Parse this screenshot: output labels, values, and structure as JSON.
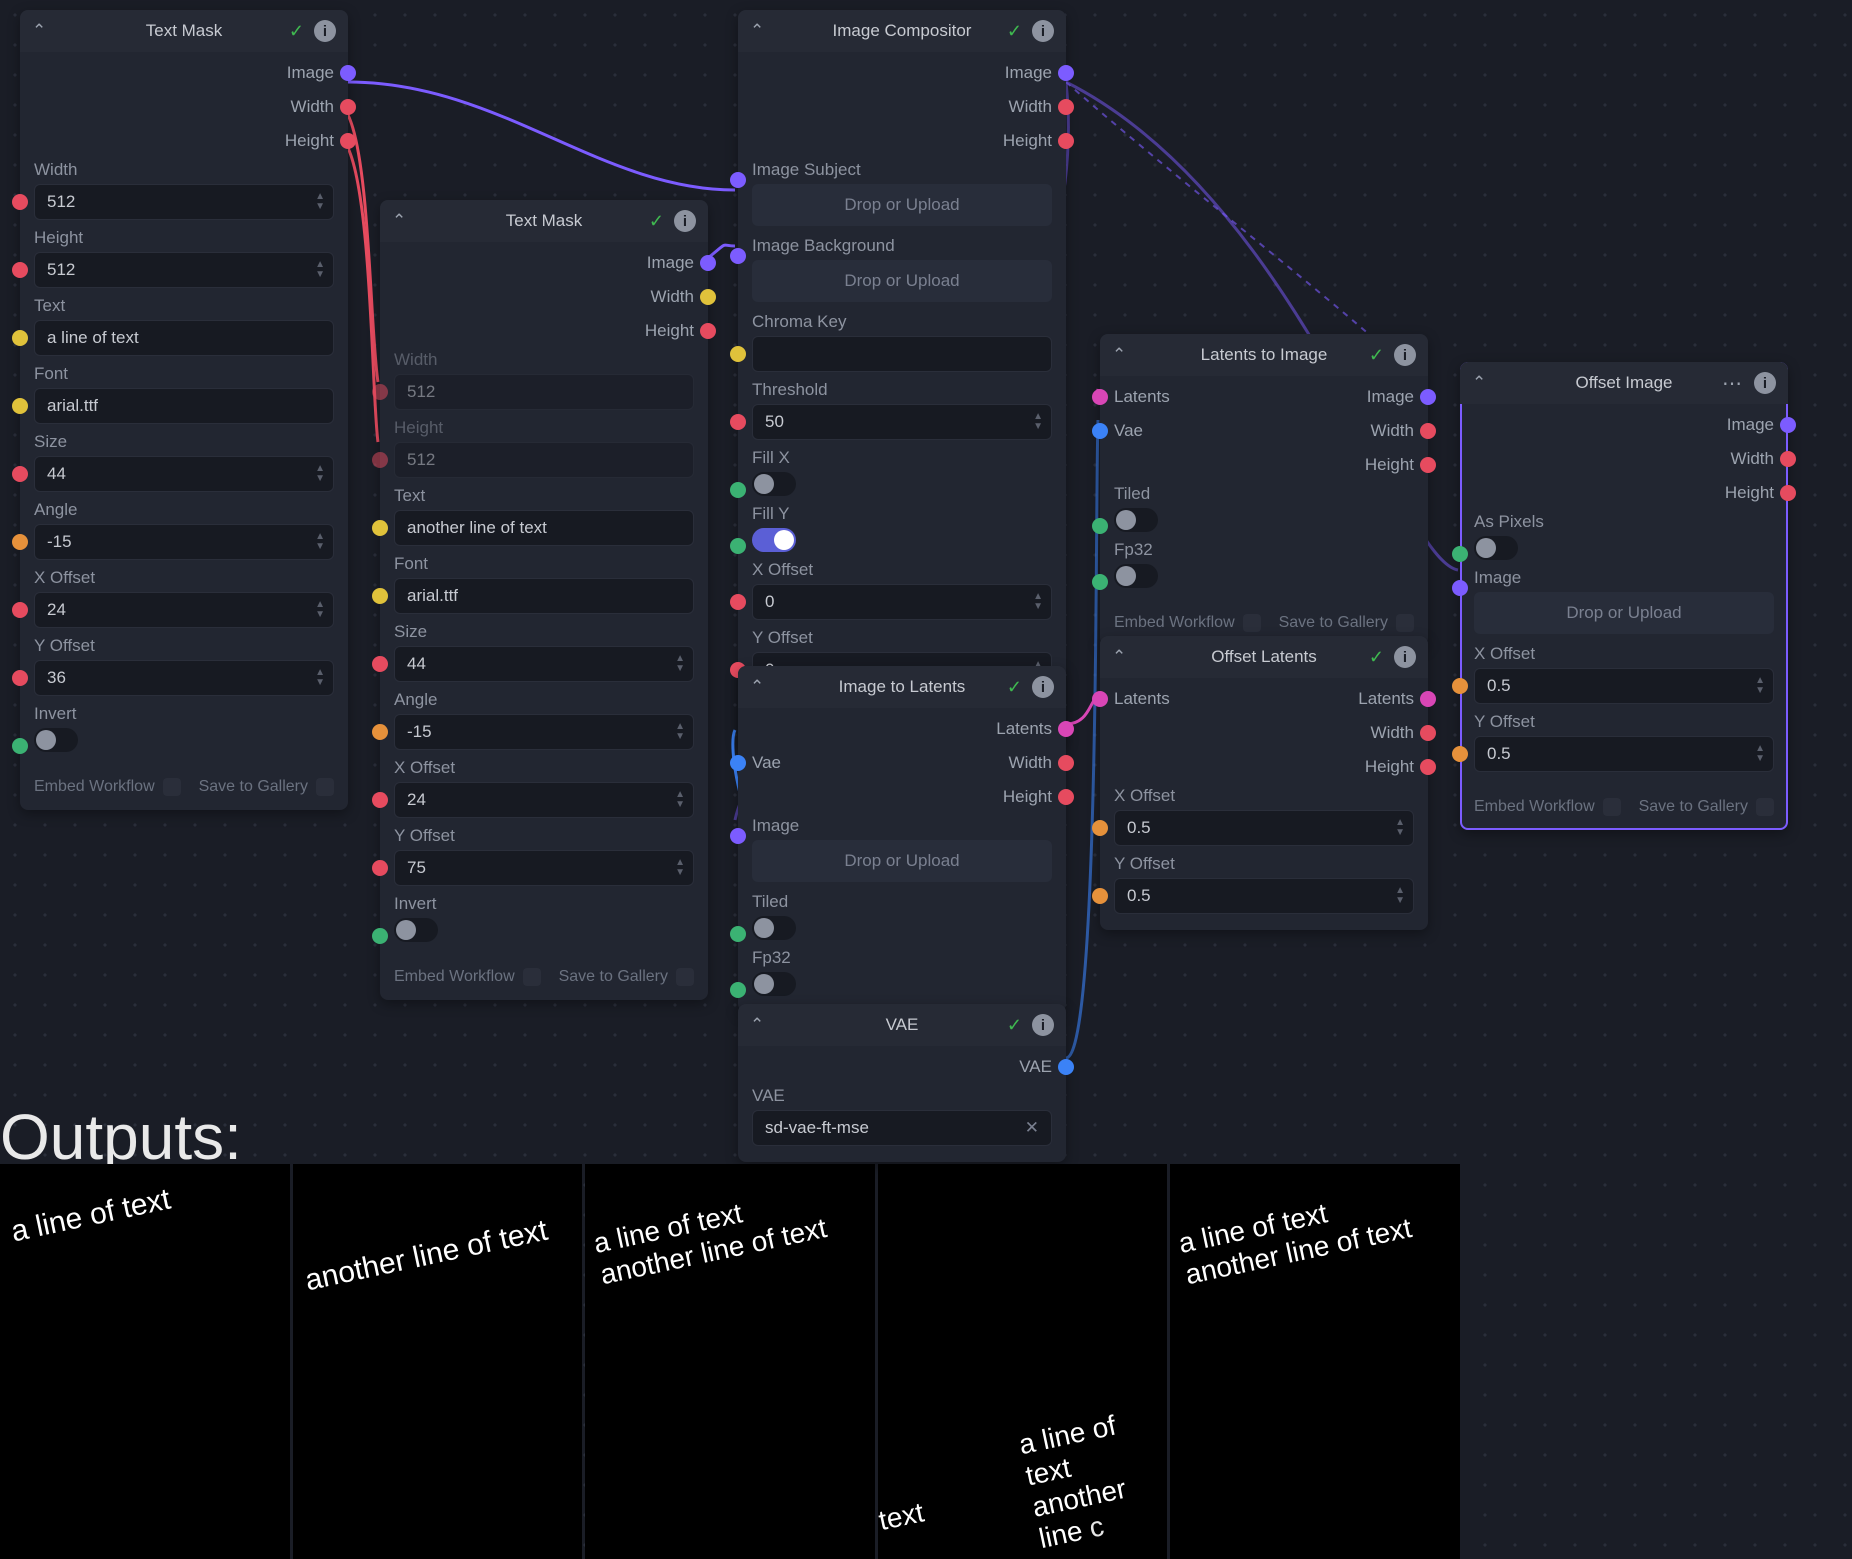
{
  "colors": {
    "purple": "#7c5cff",
    "red": "#e64b5f",
    "orange": "#e6913b",
    "yellow": "#e0c23b",
    "green": "#3bb273",
    "teal": "#2bb5b5",
    "blue": "#3b82f6",
    "magenta": "#d946b6"
  },
  "common": {
    "drop": "Drop or Upload",
    "embed": "Embed Workflow",
    "save": "Save to Gallery"
  },
  "outputs_label": "Outputs:",
  "outputs": {
    "line1": "a line of text",
    "line2": "another line of text",
    "crop": "of text"
  },
  "nodes": {
    "textmask1": {
      "title": "Text Mask",
      "outputs": [
        "Image",
        "Width",
        "Height"
      ],
      "widthLabel": "Width",
      "widthValue": "512",
      "heightLabel": "Height",
      "heightValue": "512",
      "textLabel": "Text",
      "textValue": "a line of text",
      "fontLabel": "Font",
      "fontValue": "arial.ttf",
      "sizeLabel": "Size",
      "sizeValue": "44",
      "angleLabel": "Angle",
      "angleValue": "-15",
      "xoffLabel": "X Offset",
      "xoffValue": "24",
      "yoffLabel": "Y Offset",
      "yoffValue": "36",
      "invertLabel": "Invert"
    },
    "textmask2": {
      "title": "Text Mask",
      "outputs": [
        "Image",
        "Width",
        "Height"
      ],
      "widthLabel": "Width",
      "widthValue": "512",
      "heightLabel": "Height",
      "heightValue": "512",
      "textLabel": "Text",
      "textValue": "another line of text",
      "fontLabel": "Font",
      "fontValue": "arial.ttf",
      "sizeLabel": "Size",
      "sizeValue": "44",
      "angleLabel": "Angle",
      "angleValue": "-15",
      "xoffLabel": "X Offset",
      "xoffValue": "24",
      "yoffLabel": "Y Offset",
      "yoffValue": "75",
      "invertLabel": "Invert"
    },
    "compositor": {
      "title": "Image Compositor",
      "outputs": [
        "Image",
        "Width",
        "Height"
      ],
      "subjLabel": "Image Subject",
      "bgLabel": "Image Background",
      "chromaLabel": "Chroma Key",
      "threshLabel": "Threshold",
      "threshValue": "50",
      "fillxLabel": "Fill X",
      "fillyLabel": "Fill Y",
      "xoffLabel": "X Offset",
      "xoffValue": "0",
      "yoffLabel": "Y Offset",
      "yoffValue": "0"
    },
    "i2l": {
      "title": "Image to Latents",
      "outputs": [
        "Latents",
        "Width",
        "Height"
      ],
      "vaeLabel": "Vae",
      "imageLabel": "Image",
      "tiledLabel": "Tiled",
      "fp32Label": "Fp32"
    },
    "vae": {
      "title": "VAE",
      "outLabel": "VAE",
      "fieldLabel": "VAE",
      "value": "sd-vae-ft-mse"
    },
    "l2i": {
      "title": "Latents to Image",
      "outputs": [
        "Image",
        "Width",
        "Height"
      ],
      "latLabel": "Latents",
      "vaeLabel": "Vae",
      "tiledLabel": "Tiled",
      "fp32Label": "Fp32"
    },
    "offlat": {
      "title": "Offset Latents",
      "latLabel": "Latents",
      "outputs": [
        "Latents",
        "Width",
        "Height"
      ],
      "xoffLabel": "X Offset",
      "xoffValue": "0.5",
      "yoffLabel": "Y Offset",
      "yoffValue": "0.5"
    },
    "offimg": {
      "title": "Offset Image",
      "outputs": [
        "Image",
        "Width",
        "Height"
      ],
      "asPixLabel": "As Pixels",
      "imageLabel": "Image",
      "xoffLabel": "X Offset",
      "xoffValue": "0.5",
      "yoffLabel": "Y Offset",
      "yoffValue": "0.5"
    }
  }
}
